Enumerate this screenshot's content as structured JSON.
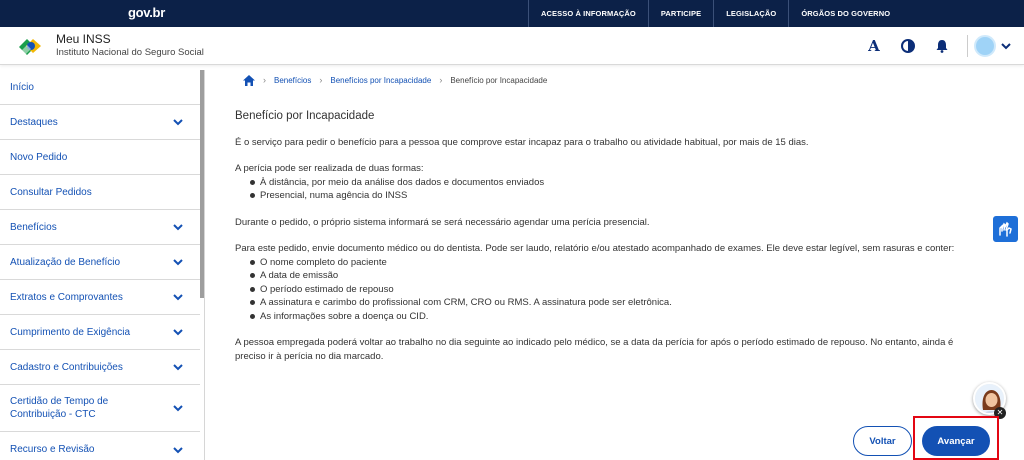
{
  "govbar": {
    "logo": "gov.br",
    "links": [
      "ACESSO À INFORMAÇÃO",
      "PARTICIPE",
      "LEGISLAÇÃO",
      "ÓRGÃOS DO GOVERNO"
    ]
  },
  "header": {
    "title": "Meu INSS",
    "subtitle": "Instituto Nacional do Seguro Social",
    "font_toggle": "A"
  },
  "sidebar": {
    "items": [
      {
        "label": "Início",
        "expandable": false
      },
      {
        "label": "Destaques",
        "expandable": true
      },
      {
        "label": "Novo Pedido",
        "expandable": false
      },
      {
        "label": "Consultar Pedidos",
        "expandable": false
      },
      {
        "label": "Benefícios",
        "expandable": true
      },
      {
        "label": "Atualização de Benefício",
        "expandable": true
      },
      {
        "label": "Extratos e Comprovantes",
        "expandable": true
      },
      {
        "label": "Cumprimento de Exigência",
        "expandable": true
      },
      {
        "label": "Cadastro e Contribuições",
        "expandable": true
      },
      {
        "label": "Certidão de Tempo de Contribuição - CTC",
        "expandable": true
      },
      {
        "label": "Recurso e Revisão",
        "expandable": true
      }
    ]
  },
  "breadcrumb": {
    "items": [
      "Benefícios",
      "Benefícios por Incapacidade",
      "Benefício por Incapacidade"
    ]
  },
  "content": {
    "title": "Benefício por Incapacidade",
    "intro": "É o serviço para pedir o benefício para a pessoa que comprove estar incapaz para o trabalho ou atividade habitual, por mais de 15 dias.",
    "forms_intro": "A perícia pode ser realizada de duas formas:",
    "forms": [
      "À distância, por meio da análise dos dados e documentos enviados",
      "Presencial, numa agência do INSS"
    ],
    "during": "Durante o pedido, o próprio sistema informará se será necessário agendar uma perícia presencial.",
    "docs_intro": "Para este pedido, envie documento médico ou do dentista. Pode ser laudo, relatório e/ou atestado acompanhado de exames. Ele deve estar legível, sem rasuras e conter:",
    "docs": [
      "O nome completo do paciente",
      "A data de emissão",
      "O período estimado de repouso",
      "A assinatura e carimbo do profissional com CRM, CRO ou RMS. A assinatura pode ser eletrônica.",
      "As informações sobre a doença ou CID."
    ],
    "return_note": "A pessoa empregada poderá voltar ao trabalho no dia seguinte ao indicado pelo médico, se a data da perícia for após o período estimado de repouso. No entanto, ainda é preciso ir à perícia no dia marcado."
  },
  "actions": {
    "back": "Voltar",
    "next": "Avançar"
  },
  "colors": {
    "govbar_bg": "#0c2148",
    "primary": "#1351b4",
    "highlight": "#e30613"
  },
  "icons": [
    "home-icon",
    "contrast-icon",
    "bell-icon",
    "chevron-down-icon",
    "vlibras-hands-icon",
    "assistant-avatar-icon",
    "close-icon"
  ]
}
